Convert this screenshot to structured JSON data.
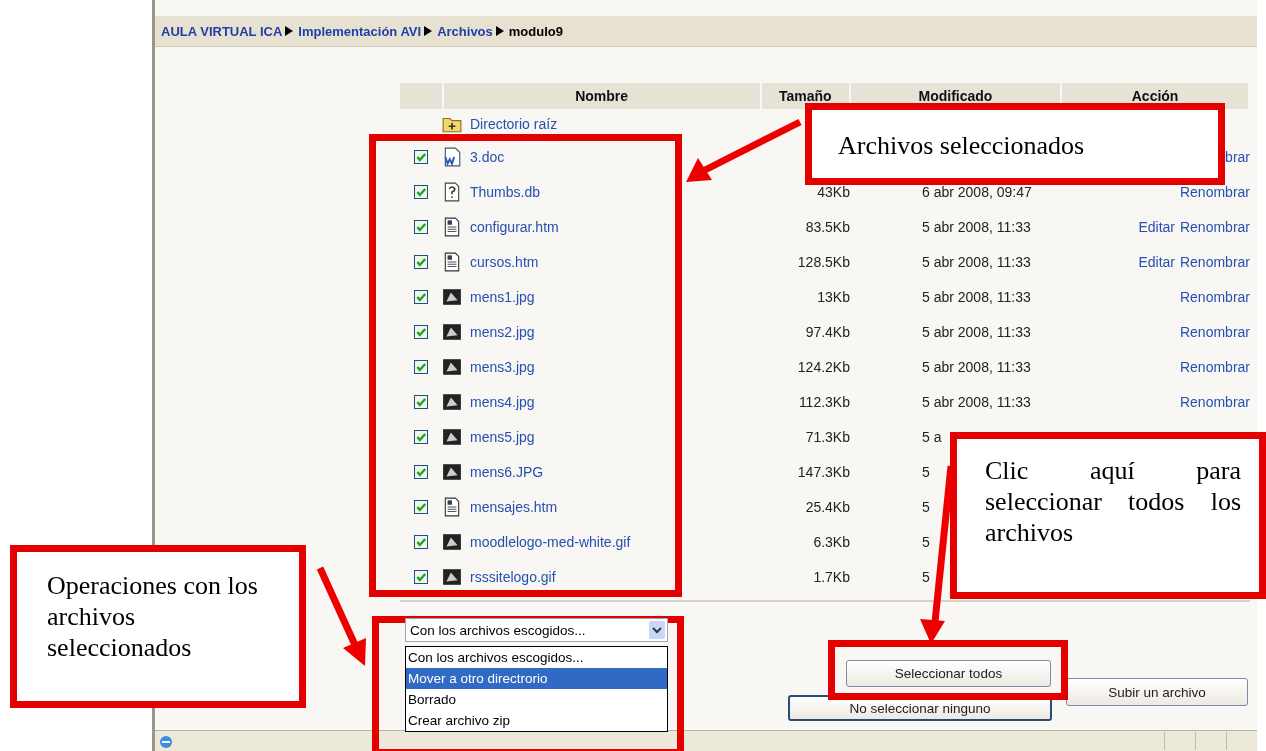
{
  "breadcrumb": [
    {
      "label": "AULA VIRTUAL ICA",
      "current": false
    },
    {
      "label": "Implementación AVI",
      "current": false
    },
    {
      "label": "Archivos",
      "current": false
    },
    {
      "label": "modulo9",
      "current": true
    }
  ],
  "table": {
    "columns": [
      "Nombre",
      "Tamaño",
      "Modificado",
      "Acción"
    ],
    "parent": {
      "name": "Directorio raíz"
    },
    "rows": [
      {
        "kind": "doc",
        "checked": true,
        "name": "3.doc",
        "actions": [
          "brar"
        ]
      },
      {
        "kind": "unknown",
        "checked": true,
        "name": "Thumbs.db",
        "size": "43Kb",
        "modified": "6 abr 2008, 09:47",
        "actions": [
          "Renombrar"
        ]
      },
      {
        "kind": "html",
        "checked": true,
        "name": "configurar.htm",
        "size": "83.5Kb",
        "modified": "5 abr 2008, 11:33",
        "actions": [
          "Editar",
          "Renombrar"
        ]
      },
      {
        "kind": "html",
        "checked": true,
        "name": "cursos.htm",
        "size": "128.5Kb",
        "modified": "5 abr 2008, 11:33",
        "actions": [
          "Editar",
          "Renombrar"
        ]
      },
      {
        "kind": "image",
        "checked": true,
        "name": "mens1.jpg",
        "size": "13Kb",
        "modified": "5 abr 2008, 11:33",
        "actions": [
          "Renombrar"
        ]
      },
      {
        "kind": "image",
        "checked": true,
        "name": "mens2.jpg",
        "size": "97.4Kb",
        "modified": "5 abr 2008, 11:33",
        "actions": [
          "Renombrar"
        ]
      },
      {
        "kind": "image",
        "checked": true,
        "name": "mens3.jpg",
        "size": "124.2Kb",
        "modified": "5 abr 2008, 11:33",
        "actions": [
          "Renombrar"
        ]
      },
      {
        "kind": "image",
        "checked": true,
        "name": "mens4.jpg",
        "size": "112.3Kb",
        "modified": "5 abr 2008, 11:33",
        "actions": [
          "Renombrar"
        ]
      },
      {
        "kind": "image",
        "checked": true,
        "name": "mens5.jpg",
        "size": "71.3Kb",
        "modified": "5 a",
        "actions": []
      },
      {
        "kind": "image",
        "checked": true,
        "name": "mens6.JPG",
        "size": "147.3Kb",
        "modified": "5",
        "actions": []
      },
      {
        "kind": "html",
        "checked": true,
        "name": "mensajes.htm",
        "size": "25.4Kb",
        "modified": "5",
        "actions": []
      },
      {
        "kind": "image",
        "checked": true,
        "name": "moodlelogo-med-white.gif",
        "size": "6.3Kb",
        "modified": "5",
        "actions": []
      },
      {
        "kind": "image",
        "checked": true,
        "name": "rsssitelogo.gif",
        "size": "1.7Kb",
        "modified": "5",
        "actions": []
      }
    ]
  },
  "operations": {
    "value": "Con los archivos escogidos...",
    "options": [
      {
        "label": "Con los archivos escogidos...",
        "highlighted": false
      },
      {
        "label": "Mover a otro directrorio",
        "highlighted": true
      },
      {
        "label": "Borrado",
        "highlighted": false
      },
      {
        "label": "Crear archivo zip",
        "highlighted": false
      }
    ]
  },
  "buttons": {
    "select_all": "Seleccionar todos",
    "select_none": "No seleccionar ninguno",
    "upload": "Subir un archivo"
  },
  "annotations": [
    {
      "kind": "callout",
      "text": "Archivos seleccionados"
    },
    {
      "kind": "callout",
      "text": "Clic aquí para seleccionar todos los archivos"
    },
    {
      "kind": "callout",
      "text": "Operaciones con los archivos seleccionados"
    }
  ]
}
